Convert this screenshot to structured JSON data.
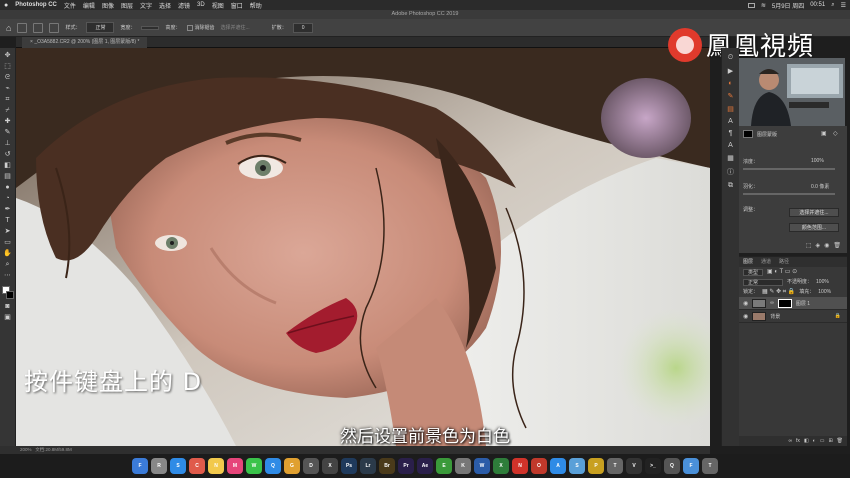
{
  "menubar": {
    "app_name": "Photoshop CC",
    "items": [
      "文件",
      "编辑",
      "图像",
      "图层",
      "文字",
      "选择",
      "滤镜",
      "3D",
      "视图",
      "窗口",
      "帮助"
    ],
    "date": "5月9日 周四",
    "time": "00:51"
  },
  "window_title": "Adobe Photoshop CC 2019",
  "options": {
    "style_label": "样式：",
    "style_value": "正常",
    "width_label": "宽度：",
    "height_label": "高度：",
    "antialias_label": "消除锯齿",
    "select_mask_label": "选择并遮住...",
    "zoom_label": "扩散：",
    "zoom_value": "0"
  },
  "document_tab": "_O3A5882.CR2 @ 200% (图层 1, 图层蒙版/8) *",
  "status": {
    "zoom": "200%",
    "doc_info": "文档:20.8M/59.8M"
  },
  "captions": {
    "left": "按件键盘上的 D",
    "bottom": "然后设置前景色为白色"
  },
  "watermark": {
    "text": "鳳凰視頻"
  },
  "properties": {
    "mask_label": "图层蒙版",
    "density_label": "浓度：",
    "density_value": "100%",
    "feather_label": "羽化：",
    "feather_value": "0.0 像素",
    "refine_label": "调整：",
    "select_mask_button": "选择并遮住...",
    "color_range_button": "颜色范围..."
  },
  "layers_panel": {
    "tabs": [
      "图层",
      "通道",
      "路径"
    ],
    "kind_label": "类型",
    "blend_mode": "正常",
    "opacity_label": "不透明度：",
    "opacity_value": "100%",
    "lock_label": "锁定：",
    "fill_label": "填充：",
    "fill_value": "100%",
    "layers": [
      {
        "name": "图层 1"
      },
      {
        "name": "背景"
      }
    ]
  },
  "dock_apps": [
    {
      "label": "F",
      "color": "#3b7bd8"
    },
    {
      "label": "R",
      "color": "#888888"
    },
    {
      "label": "S",
      "color": "#2f8be6"
    },
    {
      "label": "C",
      "color": "#e05b4b"
    },
    {
      "label": "N",
      "color": "#f2c94c"
    },
    {
      "label": "M",
      "color": "#e6457a"
    },
    {
      "label": "W",
      "color": "#3ac34a"
    },
    {
      "label": "Q",
      "color": "#2f8be6"
    },
    {
      "label": "G",
      "color": "#e0a030"
    },
    {
      "label": "D",
      "color": "#555555"
    },
    {
      "label": "X",
      "color": "#444444"
    },
    {
      "label": "Ps",
      "color": "#1f3a5c"
    },
    {
      "label": "Lr",
      "color": "#2b3a4a"
    },
    {
      "label": "Br",
      "color": "#4a3a1a"
    },
    {
      "label": "Pr",
      "color": "#2a1f4a"
    },
    {
      "label": "Ae",
      "color": "#2a1f4a"
    },
    {
      "label": "E",
      "color": "#3a9a3a"
    },
    {
      "label": "K",
      "color": "#777777"
    },
    {
      "label": "W",
      "color": "#2b5ca8"
    },
    {
      "label": "X",
      "color": "#2e7d3a"
    },
    {
      "label": "N",
      "color": "#d0332a"
    },
    {
      "label": "O",
      "color": "#c0392b"
    },
    {
      "label": "A",
      "color": "#2f8be6"
    },
    {
      "label": "S",
      "color": "#5aa0d8"
    },
    {
      "label": "P",
      "color": "#c8a020"
    },
    {
      "label": "T",
      "color": "#666666"
    },
    {
      "label": "V",
      "color": "#333333"
    },
    {
      "label": ">_",
      "color": "#222222"
    },
    {
      "label": "Q",
      "color": "#555555"
    },
    {
      "label": "F",
      "color": "#4a90d9"
    },
    {
      "label": "T",
      "color": "#666666"
    }
  ],
  "colors": {
    "accent": "#e8793a",
    "brand_red": "#e03a2c",
    "foreground_swatch": "#ffffff",
    "background_swatch": "#000000"
  }
}
